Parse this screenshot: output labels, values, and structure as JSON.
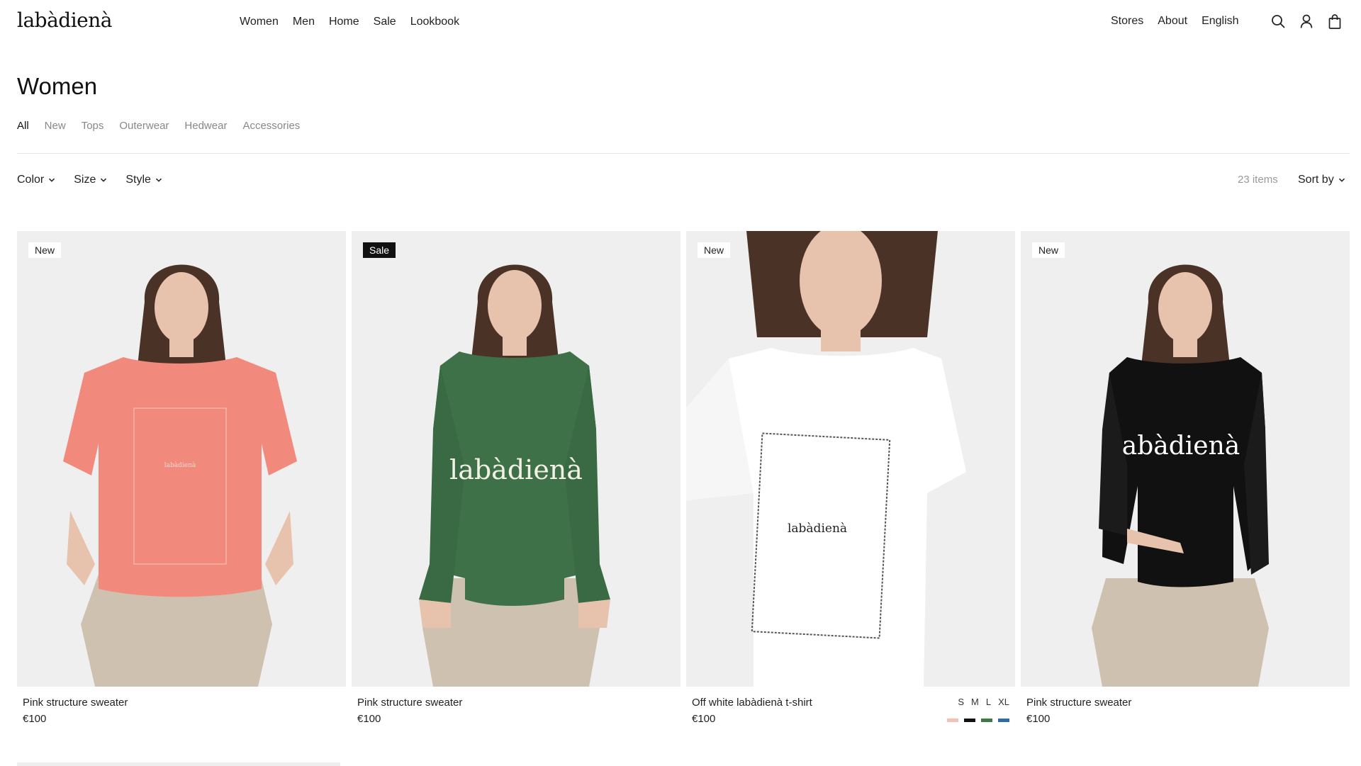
{
  "brand": {
    "logo": "labàdienà"
  },
  "nav": {
    "main": [
      "Women",
      "Men",
      "Home",
      "Sale",
      "Lookbook"
    ],
    "right": [
      "Stores",
      "About",
      "English"
    ],
    "icons": [
      "search-icon",
      "account-icon",
      "bag-icon"
    ]
  },
  "page": {
    "title": "Women",
    "categories": [
      "All",
      "New",
      "Tops",
      "Outerwear",
      "Hedwear",
      "Accessories"
    ],
    "active_category": "All"
  },
  "filters": {
    "items": [
      "Color",
      "Size",
      "Style"
    ],
    "count": "23 items",
    "sort_label": "Sort by"
  },
  "products": [
    {
      "badge": "New",
      "name": "Pink structure sweater",
      "price": "€100",
      "garment_color": "#f2897d",
      "print": "labàdienà"
    },
    {
      "badge": "Sale",
      "name": "Pink structure sweater",
      "price": "€100",
      "garment_color": "#3f7148",
      "print": "labàdienà"
    },
    {
      "badge": "New",
      "name": "Off white labàdienà t-shirt",
      "price": "€100",
      "garment_color": "#ffffff",
      "print": "labàdienà",
      "sizes": [
        "S",
        "M",
        "L",
        "XL"
      ],
      "swatches": [
        "#f3c2b4",
        "#111111",
        "#3d7a45",
        "#2f6ca6"
      ]
    },
    {
      "badge": "New",
      "name": "Pink structure sweater",
      "price": "€100",
      "garment_color": "#111111",
      "print": "abàdienà"
    }
  ],
  "colors": {
    "sale_badge_bg": "#111111",
    "page_bg": "#ffffff",
    "photo_bg": "#efefef",
    "pants": "#cfc1b0",
    "skin": "#e7c2ad",
    "hair": "#4a3326"
  }
}
